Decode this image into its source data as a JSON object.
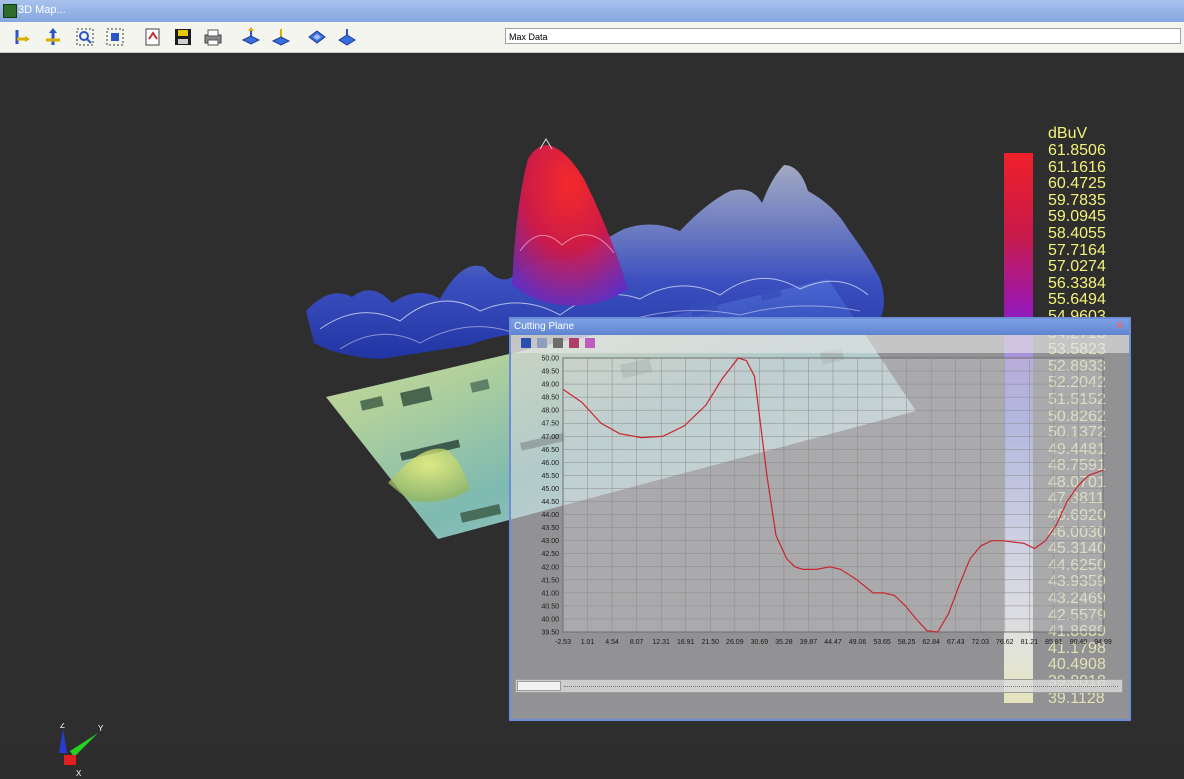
{
  "window": {
    "title": "3D Map..."
  },
  "toolbar": {
    "buttons": [
      {
        "name": "x-axis-arrow-button",
        "icon": "axis-arrow-icon"
      },
      {
        "name": "y-axis-arrow-button",
        "icon": "axis-arrow-icon"
      },
      {
        "name": "zoom-button",
        "icon": "zoom-icon"
      },
      {
        "name": "fit-view-button",
        "icon": "fit-view-icon"
      },
      {
        "name": "export-button",
        "icon": "export-icon"
      },
      {
        "name": "save-button",
        "icon": "floppy-icon"
      },
      {
        "name": "print-button",
        "icon": "printer-icon"
      },
      {
        "name": "view-top-button",
        "icon": "view-icon"
      },
      {
        "name": "view-side-button",
        "icon": "view-icon"
      },
      {
        "name": "plane-button",
        "icon": "plane-icon"
      },
      {
        "name": "plane-cut-button",
        "icon": "plane-icon"
      }
    ],
    "data_select": {
      "value": "Max Data"
    }
  },
  "colorbar": {
    "unit": "dBuV",
    "labels": [
      "61.8506",
      "61.1616",
      "60.4725",
      "59.7835",
      "59.0945",
      "58.4055",
      "57.7164",
      "57.0274",
      "56.3384",
      "55.6494",
      "54.9603",
      "54.2713",
      "53.5823",
      "52.8933",
      "52.2042",
      "51.5152",
      "50.8262",
      "50.1372",
      "49.4481",
      "48.7591",
      "48.0701",
      "47.3811",
      "46.6920",
      "46.0030",
      "45.3140",
      "44.6250",
      "43.9359",
      "43.2469",
      "42.5579",
      "41.8689",
      "41.1798",
      "40.4908",
      "39.8018",
      "39.1128"
    ],
    "colors": {
      "max": "#f0202a",
      "mid": "#5060ea",
      "min": "#fbfc90"
    }
  },
  "cutting_plane": {
    "title": "Cutting Plane",
    "close_label": "✕",
    "toolbar_icons": [
      "floppy-icon",
      "copy-icon",
      "print-icon",
      "grid-icon",
      "color-icon"
    ]
  },
  "chart_data": {
    "type": "line",
    "ylim": [
      39.5,
      50.0
    ],
    "xlim": [
      -2.53,
      97.67
    ],
    "yticks": [
      "50.00",
      "49.50",
      "49.00",
      "48.50",
      "48.00",
      "47.50",
      "47.00",
      "46.50",
      "46.00",
      "45.50",
      "45.00",
      "44.50",
      "44.00",
      "43.50",
      "43.00",
      "42.50",
      "42.00",
      "41.50",
      "41.00",
      "40.50",
      "40.00",
      "39.50"
    ],
    "xticks": [
      "-2.53",
      "1.01",
      "4.54",
      "8.07",
      "12.31",
      "16.91",
      "21.50",
      "26.09",
      "30.69",
      "35.28",
      "39.87",
      "44.47",
      "49.06",
      "53.65",
      "58.25",
      "62.84",
      "67.43",
      "72.03",
      "76.62",
      "81.21",
      "85.81",
      "90.40",
      "94.99"
    ],
    "grid": true,
    "color": "#c8262e",
    "series": [
      {
        "x": [
          -2.53,
          1.0,
          4.5,
          8.0,
          12.0,
          16.0,
          20.0,
          24.0,
          27.0,
          30.0,
          31.5,
          33.0,
          35.3,
          37.0,
          39.0,
          40.5,
          42.0,
          44.5,
          47.0,
          49.0,
          52.0,
          55.0,
          57.0,
          59.0,
          61.0,
          63.0,
          65.0,
          67.0,
          69.0,
          71.0,
          73.0,
          75.0,
          77.0,
          79.0,
          81.0,
          83.0,
          85.0,
          87.0,
          89.0,
          91.0,
          93.0,
          95.0,
          97.67
        ],
        "y": [
          48.8,
          48.3,
          47.5,
          47.1,
          46.95,
          47.0,
          47.4,
          48.2,
          49.2,
          50.0,
          49.9,
          49.3,
          45.5,
          43.2,
          42.3,
          42.0,
          41.9,
          41.9,
          42.0,
          41.9,
          41.5,
          41.0,
          41.0,
          40.9,
          40.5,
          40.0,
          39.55,
          39.5,
          40.2,
          41.3,
          42.3,
          42.8,
          43.0,
          43.0,
          42.95,
          42.9,
          42.7,
          43.0,
          43.6,
          44.5,
          45.1,
          45.5,
          45.7
        ]
      }
    ]
  },
  "axes_widget": {
    "x": "X",
    "y": "Y",
    "z": "Z"
  }
}
